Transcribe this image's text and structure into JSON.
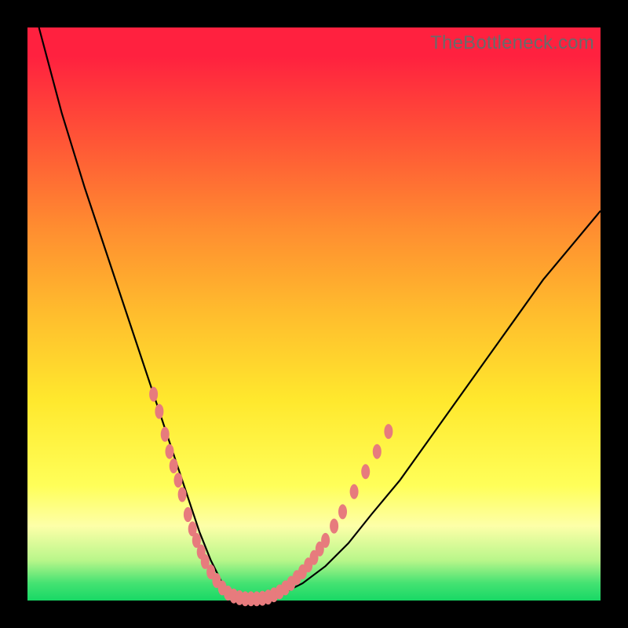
{
  "watermark": "TheBottleneck.com",
  "chart_data": {
    "type": "line",
    "title": "",
    "xlabel": "",
    "ylabel": "",
    "xlim": [
      0,
      100
    ],
    "ylim": [
      0,
      100
    ],
    "series": [
      {
        "name": "curve",
        "x": [
          2,
          6,
          10,
          14,
          18,
          22,
          24,
          26,
          28,
          30,
          32,
          34,
          36,
          38,
          40,
          44,
          48,
          52,
          56,
          60,
          65,
          70,
          75,
          80,
          85,
          90,
          95,
          100
        ],
        "values": [
          100,
          85,
          72,
          60,
          48,
          36,
          30,
          24,
          18,
          12,
          7,
          3,
          1,
          0.4,
          0.3,
          1,
          3,
          6,
          10,
          15,
          21,
          28,
          35,
          42,
          49,
          56,
          62,
          68
        ]
      }
    ],
    "markers": {
      "name": "pink-segments",
      "points": [
        {
          "x": 22.0,
          "y": 36.0
        },
        {
          "x": 23.0,
          "y": 33.0
        },
        {
          "x": 24.0,
          "y": 29.0
        },
        {
          "x": 24.8,
          "y": 26.0
        },
        {
          "x": 25.5,
          "y": 23.5
        },
        {
          "x": 26.3,
          "y": 21.0
        },
        {
          "x": 27.0,
          "y": 18.5
        },
        {
          "x": 28.0,
          "y": 15.0
        },
        {
          "x": 28.8,
          "y": 12.5
        },
        {
          "x": 29.5,
          "y": 10.5
        },
        {
          "x": 30.3,
          "y": 8.5
        },
        {
          "x": 31.0,
          "y": 6.8
        },
        {
          "x": 32.0,
          "y": 5.0
        },
        {
          "x": 33.0,
          "y": 3.5
        },
        {
          "x": 34.0,
          "y": 2.2
        },
        {
          "x": 35.0,
          "y": 1.3
        },
        {
          "x": 36.0,
          "y": 0.8
        },
        {
          "x": 37.0,
          "y": 0.5
        },
        {
          "x": 38.0,
          "y": 0.3
        },
        {
          "x": 39.0,
          "y": 0.3
        },
        {
          "x": 40.0,
          "y": 0.3
        },
        {
          "x": 41.0,
          "y": 0.4
        },
        {
          "x": 42.0,
          "y": 0.6
        },
        {
          "x": 43.0,
          "y": 1.0
        },
        {
          "x": 44.0,
          "y": 1.5
        },
        {
          "x": 45.0,
          "y": 2.2
        },
        {
          "x": 46.0,
          "y": 3.0
        },
        {
          "x": 47.0,
          "y": 4.0
        },
        {
          "x": 48.0,
          "y": 5.0
        },
        {
          "x": 49.0,
          "y": 6.2
        },
        {
          "x": 50.0,
          "y": 7.5
        },
        {
          "x": 51.0,
          "y": 9.0
        },
        {
          "x": 52.0,
          "y": 10.5
        },
        {
          "x": 53.5,
          "y": 13.0
        },
        {
          "x": 55.0,
          "y": 15.5
        },
        {
          "x": 57.0,
          "y": 19.0
        },
        {
          "x": 59.0,
          "y": 22.5
        },
        {
          "x": 61.0,
          "y": 26.0
        },
        {
          "x": 63.0,
          "y": 29.5
        }
      ]
    },
    "gradient": [
      {
        "pos": 0,
        "color": "#ff213f"
      },
      {
        "pos": 20,
        "color": "#ff5636"
      },
      {
        "pos": 35,
        "color": "#ff8d30"
      },
      {
        "pos": 50,
        "color": "#ffbd2d"
      },
      {
        "pos": 65,
        "color": "#ffe82d"
      },
      {
        "pos": 80,
        "color": "#ffff59"
      },
      {
        "pos": 87,
        "color": "#fdffa8"
      },
      {
        "pos": 93,
        "color": "#b8f68a"
      },
      {
        "pos": 97,
        "color": "#44e272"
      },
      {
        "pos": 100,
        "color": "#18d865"
      }
    ],
    "colors": {
      "frame": "#000000",
      "curve": "#000000",
      "marker": "#e77b7d"
    }
  }
}
